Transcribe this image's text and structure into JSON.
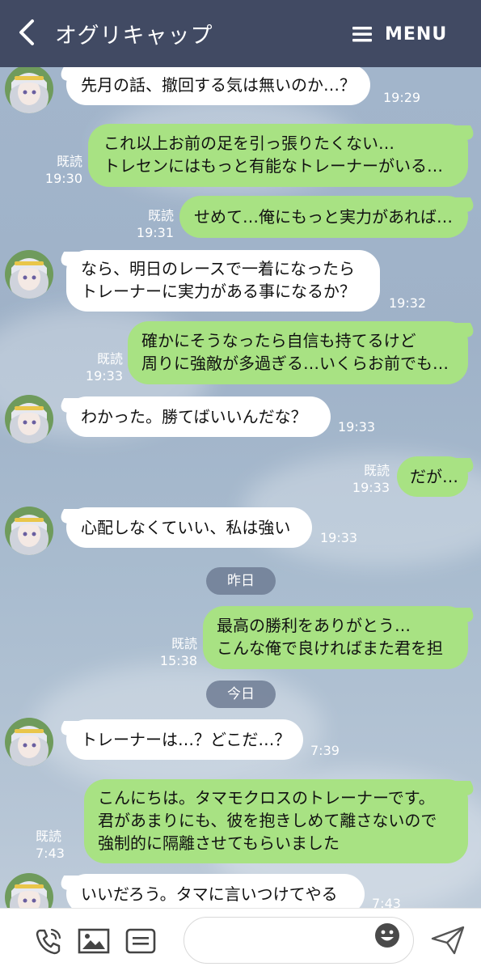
{
  "header": {
    "title": "オグリキャップ",
    "menu_label": "MENU"
  },
  "messages": [
    {
      "lines": [
        "先月の話、撤回する気は無いのか…？"
      ],
      "time": "19:29"
    },
    {
      "lines": [
        "これ以上お前の足を引っ張りたくない…",
        "トレセンにはもっと有能なトレーナーがいる…"
      ],
      "read": "既読",
      "time": "19:30"
    },
    {
      "lines": [
        "せめて…俺にもっと実力があれば…"
      ],
      "read": "既読",
      "time": "19:31"
    },
    {
      "lines": [
        "なら、明日のレースで一着になったら",
        "トレーナーに実力がある事になるか？"
      ],
      "time": "19:32"
    },
    {
      "lines": [
        "確かにそうなったら自信も持てるけど",
        "周りに強敵が多過ぎる…いくらお前でも…"
      ],
      "read": "既読",
      "time": "19:33"
    },
    {
      "lines": [
        "わかった。勝てばいいんだな？"
      ],
      "time": "19:33"
    },
    {
      "lines": [
        "だが…"
      ],
      "read": "既読",
      "time": "19:33"
    },
    {
      "lines": [
        "心配しなくていい、私は強い"
      ],
      "time": "19:33"
    },
    {
      "lines": [
        "最高の勝利をありがとう…",
        "こんな俺で良ければまた君を担"
      ],
      "read": "既読",
      "time": "15:38"
    },
    {
      "lines": [
        "トレーナーは…？どこだ…？"
      ],
      "time": "7:39"
    },
    {
      "lines": [
        "こんにちは。タマモクロスのトレーナーです。",
        "君があまりにも、彼を抱きしめて離さないので",
        "強制的に隔離させてもらいました"
      ],
      "read": "既読",
      "time": "7:43"
    },
    {
      "lines": [
        "いいだろう。タマに言いつけてやる"
      ],
      "time": "7:43"
    }
  ],
  "date_separators": [
    "昨日",
    "今日"
  ],
  "input": {
    "placeholder": ""
  },
  "icons": [
    "back-chevron-icon",
    "hamburger-menu-icon",
    "phone-icon",
    "image-icon",
    "keyboard-list-icon",
    "emoji-icon",
    "send-icon"
  ],
  "colors": {
    "header_bg": "#414a63",
    "outgoing_bubble": "#a8e283",
    "incoming_bubble": "#ffffff",
    "background": "#a3b6cc"
  }
}
